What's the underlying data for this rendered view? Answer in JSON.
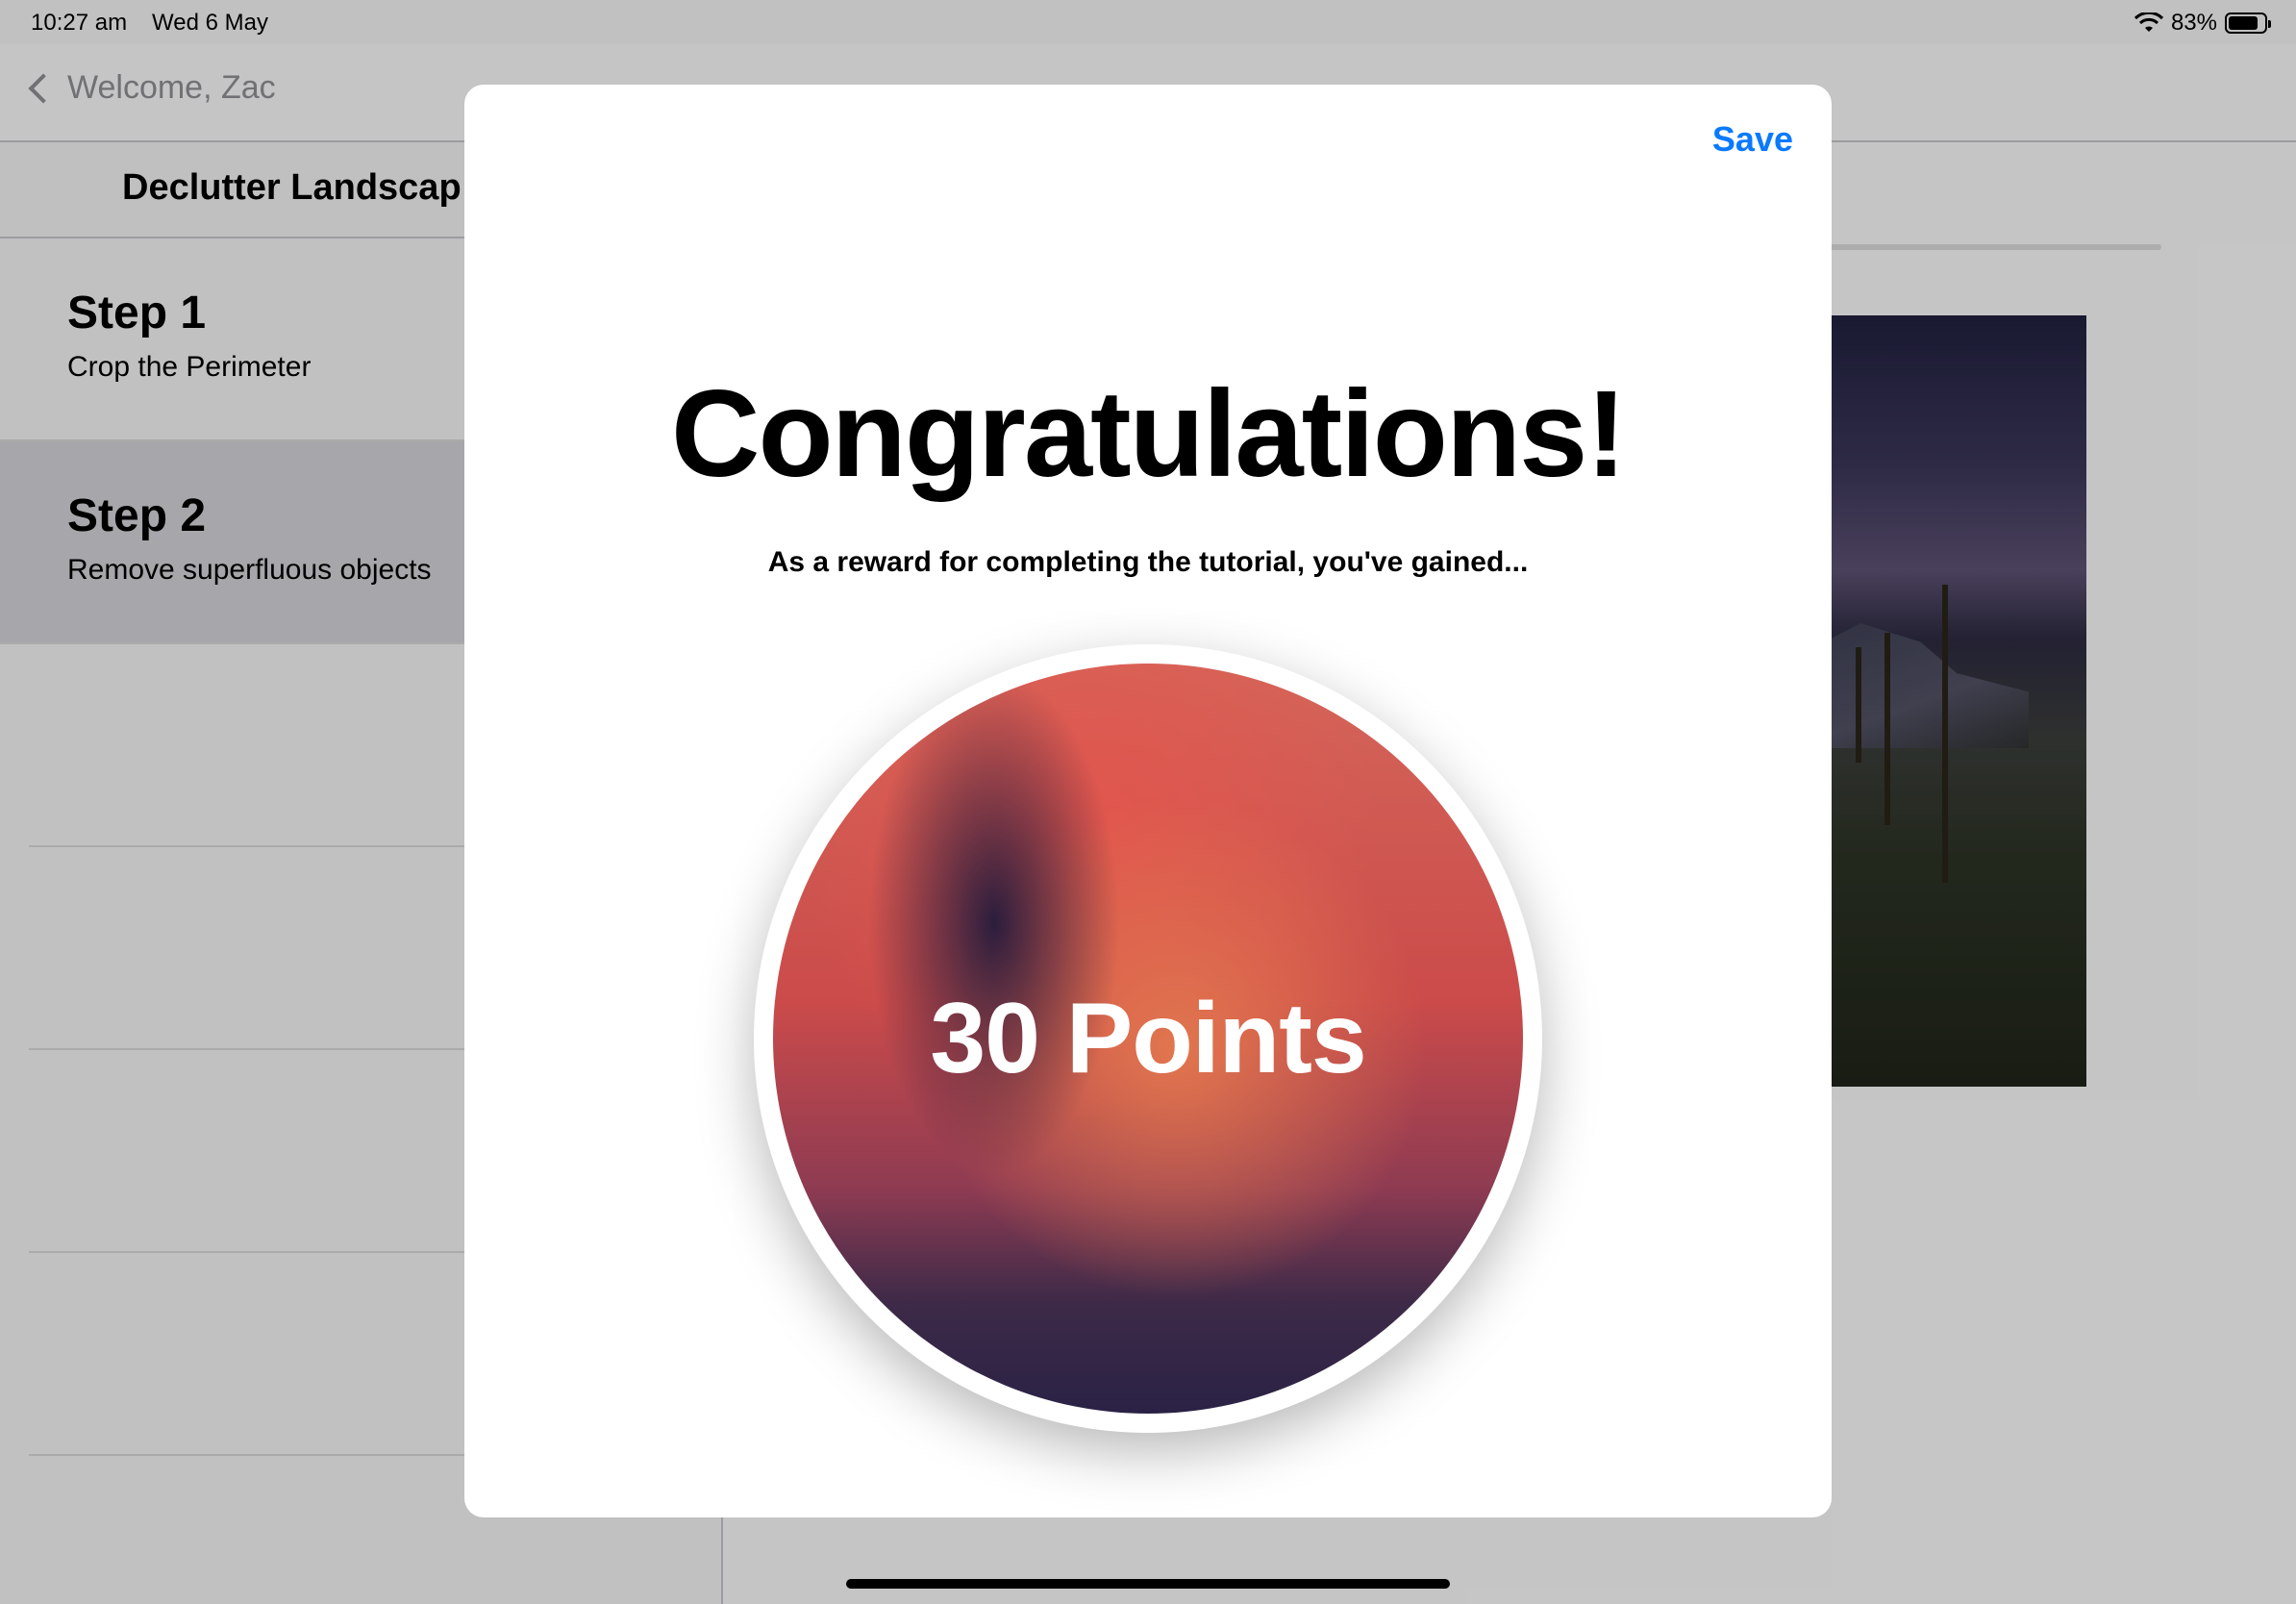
{
  "status_bar": {
    "time": "10:27 am",
    "date": "Wed 6 May",
    "battery": "83%",
    "battery_level": 0.83,
    "icons": [
      "wifi-icon",
      "battery-icon"
    ]
  },
  "nav": {
    "back_label": "Welcome, Zac"
  },
  "sidebar": {
    "title": "Declutter Landscap",
    "steps": [
      {
        "title": "Step 1",
        "subtitle": "Crop the Perimeter",
        "selected": false
      },
      {
        "title": "Step 2",
        "subtitle": "Remove superfluous objects",
        "selected": true
      }
    ]
  },
  "modal": {
    "save_label": "Save",
    "title": "Congratulations!",
    "reward_text": "As a reward for completing the tutorial, you've gained...",
    "points_label": "30 Points"
  },
  "colors": {
    "accent": "#0a7aff",
    "selected_row": "#d1d1d6"
  }
}
